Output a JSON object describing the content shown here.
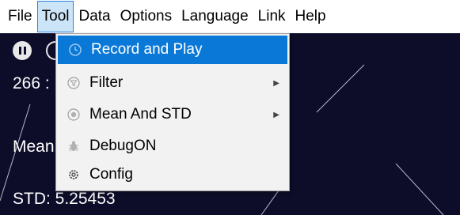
{
  "menubar": {
    "items": [
      "File",
      "Tool",
      "Data",
      "Options",
      "Language",
      "Link",
      "Help"
    ],
    "active": "Tool"
  },
  "plot": {
    "value_partial": "266 :",
    "mean_partial": "Mean",
    "std": "STD: 5.25453"
  },
  "tool_menu": {
    "items": [
      {
        "label": "Record and Play",
        "icon": "clock-icon",
        "submenu": false
      },
      {
        "label": "Filter",
        "icon": "filter-icon",
        "submenu": true
      },
      {
        "label": "Mean And STD",
        "icon": "mean-icon",
        "submenu": true
      },
      {
        "label": "DebugON",
        "icon": "bug-icon",
        "submenu": false
      },
      {
        "label": "Config",
        "icon": "gear-icon",
        "submenu": false
      }
    ]
  },
  "colors": {
    "highlight": "#0a78d7",
    "plot_bg": "#0d0d2a",
    "menu_active_bg": "#cce4f7"
  }
}
